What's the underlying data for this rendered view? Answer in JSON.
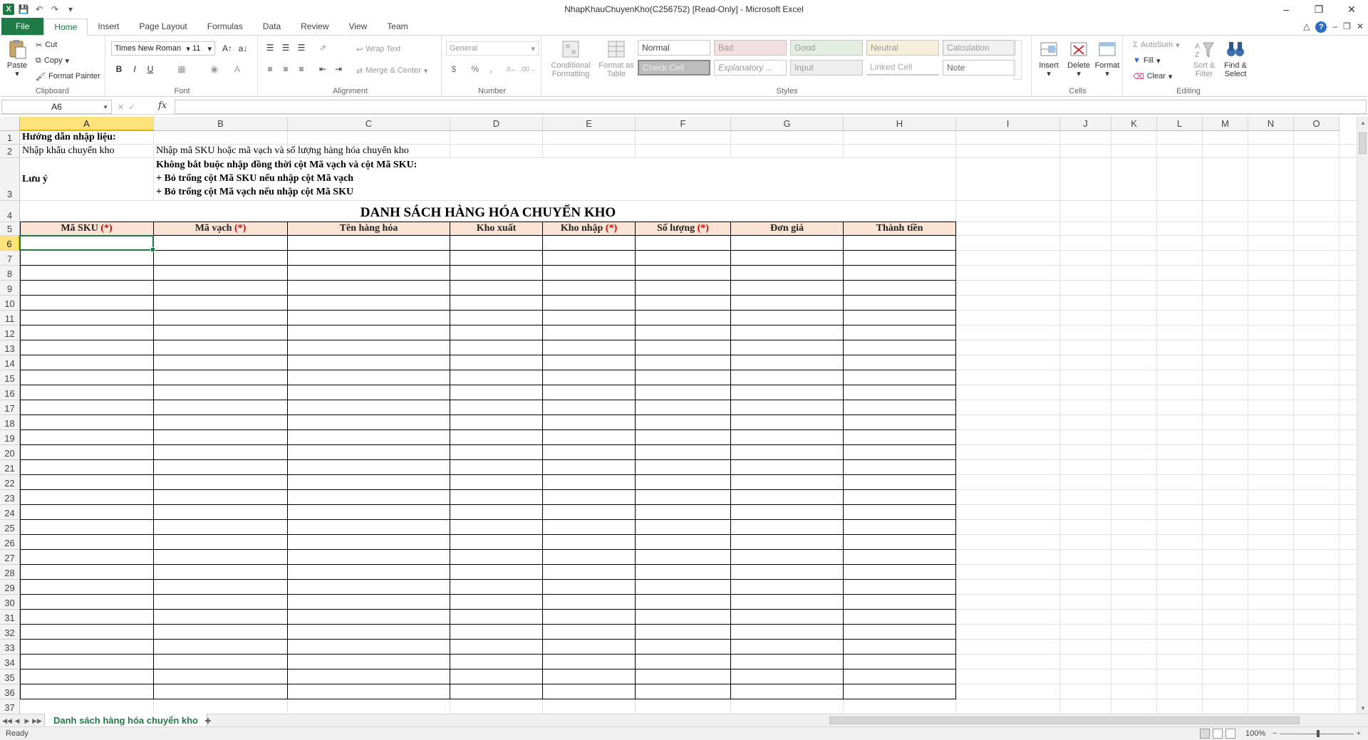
{
  "window": {
    "title": "NhapKhauChuyenKho(C256752)  [Read-Only]  -  Microsoft Excel"
  },
  "ribbon_tabs": [
    "File",
    "Home",
    "Insert",
    "Page Layout",
    "Formulas",
    "Data",
    "Review",
    "View",
    "Team"
  ],
  "ribbon": {
    "clipboard": {
      "label": "Clipboard",
      "paste": "Paste",
      "cut": "Cut",
      "copy": "Copy",
      "format_painter": "Format Painter"
    },
    "font": {
      "label": "Font",
      "font_name": "Times New Roman",
      "font_size": "11",
      "bold": "B",
      "italic": "I",
      "underline": "U"
    },
    "alignment": {
      "label": "Alignment",
      "wrap_text": "Wrap Text",
      "merge_center": "Merge & Center"
    },
    "number": {
      "label": "Number",
      "format": "General",
      "currency": "$",
      "percent": "%",
      "comma": ","
    },
    "styles": {
      "label": "Styles",
      "conditional_formatting": "Conditional Formatting",
      "format_as_table": "Format as Table",
      "cells": [
        "Normal",
        "Bad",
        "Good",
        "Neutral",
        "Calculation",
        "Check Cell",
        "Explanatory ...",
        "Input",
        "Linked Cell",
        "Note"
      ]
    },
    "cells": {
      "label": "Cells",
      "insert": "Insert",
      "delete": "Delete",
      "format": "Format"
    },
    "editing": {
      "label": "Editing",
      "autosum": "AutoSum",
      "fill": "Fill",
      "clear": "Clear",
      "sort_filter": "Sort & Filter",
      "find_select": "Find & Select"
    }
  },
  "formula_bar": {
    "name_box": "A6",
    "fx": "fx",
    "formula": ""
  },
  "columns": [
    "A",
    "B",
    "C",
    "D",
    "E",
    "F",
    "G",
    "H",
    "I",
    "J",
    "K",
    "L",
    "M",
    "N",
    "O"
  ],
  "rows": [
    "1",
    "2",
    "3",
    "4",
    "5",
    "6",
    "7",
    "8",
    "9",
    "10",
    "11",
    "12",
    "13",
    "14",
    "15",
    "16",
    "17",
    "18",
    "19",
    "20",
    "21",
    "22",
    "23",
    "24",
    "25",
    "26",
    "27",
    "28",
    "29",
    "30",
    "31",
    "32",
    "33",
    "34",
    "35",
    "36",
    "37"
  ],
  "sheet": {
    "r1_a": "Hướng dẫn nhập liệu:",
    "r2_a": "Nhập khẩu chuyển kho",
    "r2_b": "Nhập mã SKU hoặc mã vạch và số lượng hàng hóa chuyển kho",
    "r3_a": "Lưu ý",
    "r3_b1": "Không bắt buộc nhập đồng thời cột Mã vạch và cột Mã SKU:",
    "r3_b2": "+ Bỏ trống cột Mã SKU nếu nhập cột Mã vạch",
    "r3_b3": "+ Bỏ trống cột Mã vạch nếu nhập cột Mã SKU",
    "r4_title": "DANH SÁCH HÀNG HÓA CHUYỂN KHO",
    "headers": [
      {
        "text": "Mã SKU",
        "req": "(*)"
      },
      {
        "text": "Mã vạch",
        "req": "(*)"
      },
      {
        "text": "Tên hàng hóa",
        "req": ""
      },
      {
        "text": "Kho xuất",
        "req": ""
      },
      {
        "text": "Kho nhập",
        "req": "(*)"
      },
      {
        "text": "Số lượng",
        "req": "(*)"
      },
      {
        "text": "Đơn giá",
        "req": ""
      },
      {
        "text": "Thành tiền",
        "req": ""
      }
    ]
  },
  "sheet_tabs": [
    "Danh sách hàng hóa chuyển kho"
  ],
  "status": {
    "ready": "Ready",
    "zoom": "100%"
  }
}
